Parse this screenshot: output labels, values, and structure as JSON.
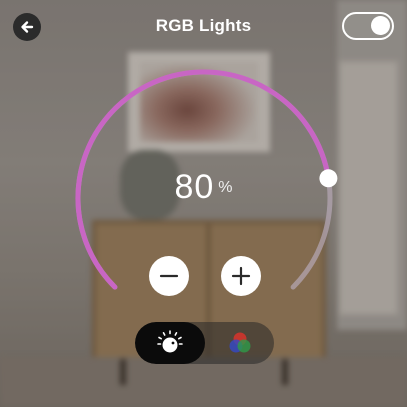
{
  "header": {
    "title": "RGB Lights",
    "back_icon": "arrow-left-icon",
    "power_toggle": {
      "state": "on"
    }
  },
  "brightness": {
    "value": "80",
    "unit": "%",
    "level": 0.8
  },
  "controls": {
    "decrease_icon": "minus-icon",
    "increase_icon": "plus-icon"
  },
  "modes": {
    "active": "brightness",
    "items": [
      {
        "id": "brightness",
        "icon": "brightness-dial-icon"
      },
      {
        "id": "color",
        "icon": "rgb-circles-icon"
      }
    ]
  },
  "colors": {
    "arc": "#c866c4",
    "arc_track": "#b6a8b6",
    "accent_red": "#d8342c",
    "accent_green": "#2e9a48",
    "accent_blue": "#3348c8"
  }
}
